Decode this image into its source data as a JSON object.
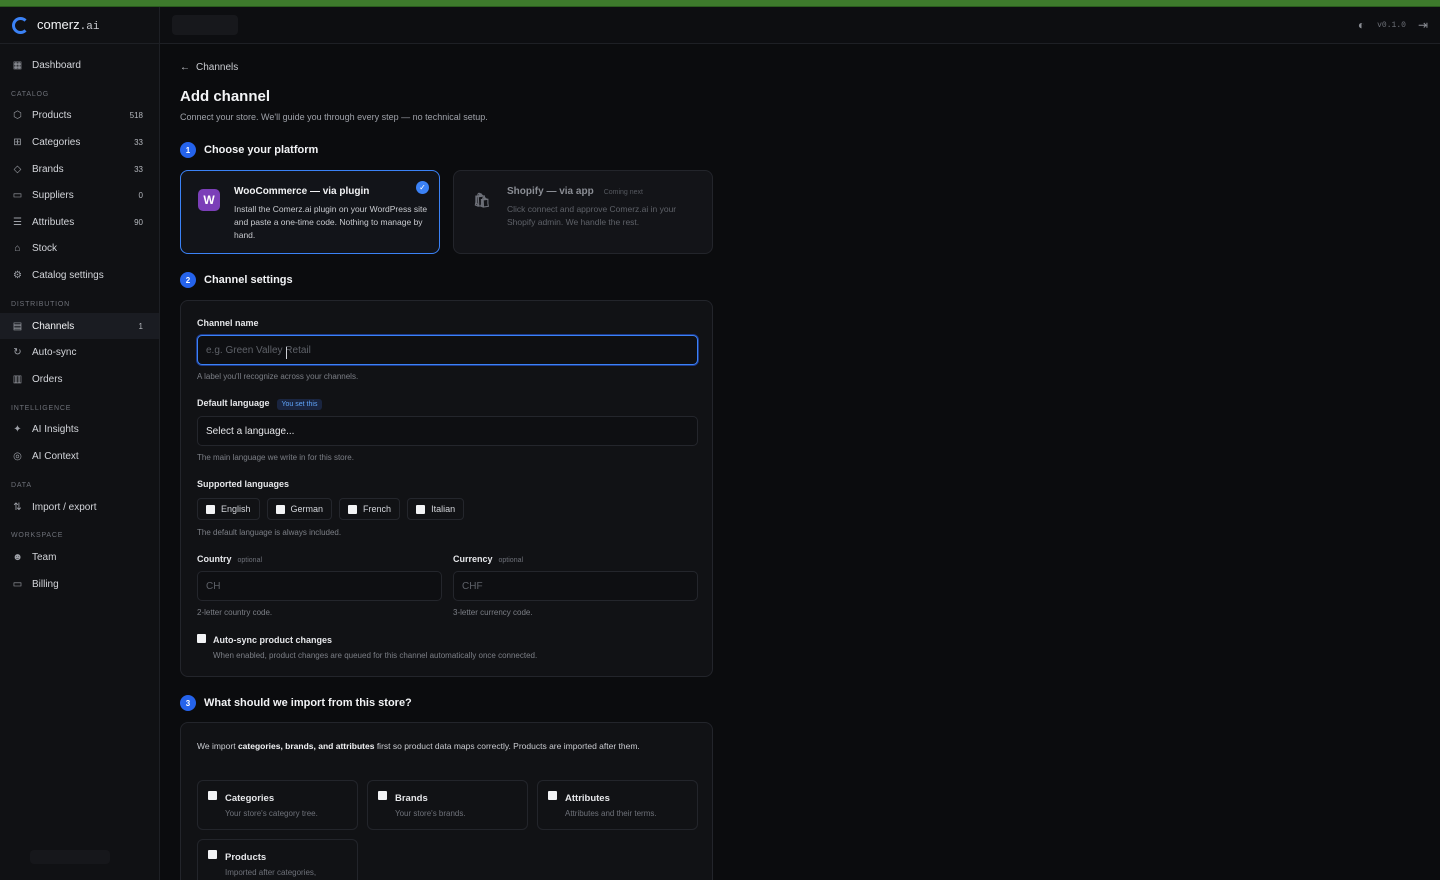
{
  "app": {
    "name": "comerz",
    "name_suffix": ".ai",
    "version": "v0.1.0"
  },
  "sidebar": {
    "dashboard": "Dashboard",
    "sections": {
      "catalog": "CATALOG",
      "distribution": "DISTRIBUTION",
      "intelligence": "INTELLIGENCE",
      "data": "DATA",
      "workspace": "WORKSPACE"
    },
    "catalog_items": [
      {
        "label": "Products",
        "count": "518",
        "icon": "box-icon"
      },
      {
        "label": "Categories",
        "count": "33",
        "icon": "tree-icon"
      },
      {
        "label": "Brands",
        "count": "33",
        "icon": "tag-icon"
      },
      {
        "label": "Suppliers",
        "count": "0",
        "icon": "truck-icon"
      },
      {
        "label": "Attributes",
        "count": "90",
        "icon": "list-icon"
      },
      {
        "label": "Stock",
        "count": "",
        "icon": "warehouse-icon"
      },
      {
        "label": "Catalog settings",
        "count": "",
        "icon": "gear-icon"
      }
    ],
    "distribution_items": [
      {
        "label": "Channels",
        "count": "1",
        "icon": "channels-icon",
        "active": true
      },
      {
        "label": "Auto-sync",
        "count": "",
        "icon": "sync-icon"
      },
      {
        "label": "Orders",
        "count": "",
        "icon": "orders-icon"
      }
    ],
    "intelligence_items": [
      {
        "label": "AI Insights",
        "icon": "sparkle-icon"
      },
      {
        "label": "AI Context",
        "icon": "brain-icon"
      }
    ],
    "data_items": [
      {
        "label": "Import / export",
        "icon": "import-export-icon"
      }
    ],
    "workspace_items": [
      {
        "label": "Team",
        "icon": "team-icon"
      },
      {
        "label": "Billing",
        "icon": "billing-icon"
      }
    ]
  },
  "page": {
    "back_label": "Channels",
    "title": "Add channel",
    "subtitle": "Connect your store. We'll guide you through every step — no technical setup."
  },
  "step1": {
    "num": "1",
    "title": "Choose your platform",
    "woo": {
      "icon_letter": "W",
      "title": "WooCommerce — via plugin",
      "desc": "Install the Comerz.ai plugin on your WordPress site and paste a one-time code. Nothing to manage by hand.",
      "selected": true
    },
    "shopify": {
      "title": "Shopify — via app",
      "badge": "Coming next",
      "desc": "Click connect and approve Comerz.ai in your Shopify admin. We handle the rest."
    }
  },
  "step2": {
    "num": "2",
    "title": "Channel settings",
    "channel_name": {
      "label": "Channel name",
      "placeholder": "e.g. Green Valley Retail",
      "hint": "A label you'll recognize across your channels."
    },
    "default_language": {
      "label": "Default language",
      "badge": "You set this",
      "value": "Select a language...",
      "hint": "The main language we write in for this store."
    },
    "supported_languages": {
      "label": "Supported languages",
      "options": [
        "English",
        "German",
        "French",
        "Italian"
      ],
      "hint": "The default language is always included."
    },
    "country": {
      "label": "Country",
      "optional": "optional",
      "placeholder": "CH",
      "hint": "2-letter country code."
    },
    "currency": {
      "label": "Currency",
      "optional": "optional",
      "placeholder": "CHF",
      "hint": "3-letter currency code."
    },
    "autosync": {
      "label": "Auto-sync product changes",
      "desc": "When enabled, product changes are queued for this channel automatically once connected."
    }
  },
  "step3": {
    "num": "3",
    "title": "What should we import from this store?",
    "intro_pre": "We import ",
    "intro_bold": "categories, brands, and attributes",
    "intro_post": " first so product data maps correctly. Products are imported after them.",
    "items": [
      {
        "title": "Categories",
        "desc": "Your store's category tree."
      },
      {
        "title": "Brands",
        "desc": "Your store's brands."
      },
      {
        "title": "Attributes",
        "desc": "Attributes and their terms."
      },
      {
        "title": "Products",
        "desc": "Imported after categories,"
      }
    ]
  },
  "colors": {
    "accent": "#3b82f6",
    "woo": "#7b3fb8",
    "topstrip": "#3d7a2c"
  }
}
